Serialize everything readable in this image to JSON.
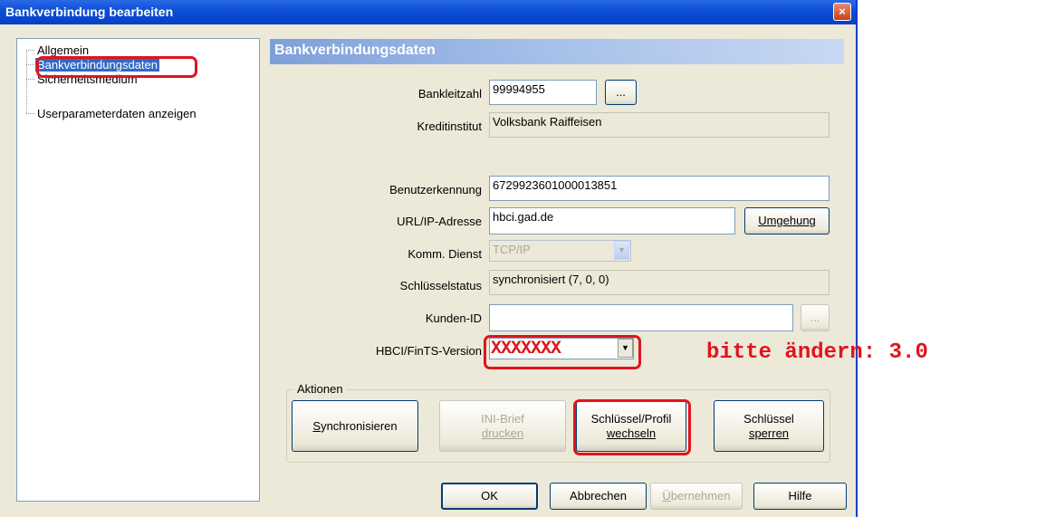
{
  "window": {
    "title": "Bankverbindung bearbeiten",
    "close_glyph": "×"
  },
  "tree": {
    "items": [
      {
        "label": "Allgemein",
        "selected": false
      },
      {
        "label": "Bankverbindungsdaten",
        "selected": true
      },
      {
        "label": "Sicherheitsmedium",
        "selected": false
      },
      {
        "label": "Userparameterdaten anzeigen",
        "selected": false
      }
    ]
  },
  "panel": {
    "header": "Bankverbindungsdaten",
    "bankleitzahl_label": "Bankleitzahl",
    "bankleitzahl_value": "99994955",
    "browse_label": "...",
    "kreditinstitut_label": "Kreditinstitut",
    "kreditinstitut_value": "Volksbank Raiffeisen",
    "benutzerkennung_label": "Benutzerkennung",
    "benutzerkennung_value": "6729923601000013851",
    "url_label": "URL/IP-Adresse",
    "url_value": "hbci.gad.de",
    "umgehung_label": "Umgehung",
    "komm_label": "Komm. Dienst",
    "komm_value": "TCP/IP",
    "schluesselstatus_label": "Schlüsselstatus",
    "schluesselstatus_value": "synchronisiert (7, 0, 0)",
    "kunden_label": "Kunden-ID",
    "kunden_value": "",
    "kunden_browse_label": "...",
    "version_label": "HBCI/FinTS-Version",
    "version_value": "XXXXXXX"
  },
  "actions": {
    "legend": "Aktionen",
    "synchronisieren": {
      "underlined": "S",
      "rest": "ynchronisieren"
    },
    "ini_brief_line1": "INI-Brief",
    "ini_brief_line2": "drucken",
    "schluessel_profil_line1": "Schlüssel/Profil",
    "schluessel_profil_line2": "wechseln",
    "schluessel_sperren_line1": "Schlüssel",
    "schluessel_sperren_line2": "sperren"
  },
  "footer": {
    "ok": "OK",
    "abbrechen": "Abbrechen",
    "uebernehmen": {
      "underlined": "Ü",
      "rest": "bernehmen"
    },
    "hilfe": "Hilfe"
  },
  "annotation": {
    "text": "bitte ändern: 3.0"
  },
  "colors": {
    "title_bar": "#0a4ed8",
    "selection": "#316ac5",
    "annotation_red": "#e0141e",
    "dialog_bg": "#ece9d8"
  }
}
